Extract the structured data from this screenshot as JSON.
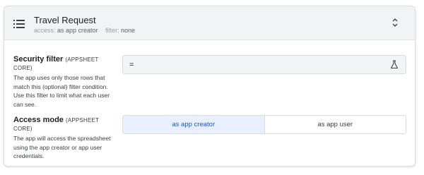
{
  "header": {
    "title": "Travel Request",
    "access_key": "access:",
    "access_value": "as app creator",
    "filter_key": "filter:",
    "filter_value": "none"
  },
  "security_filter": {
    "title": "Security filter",
    "tag": "(APPSHEET CORE)",
    "description": "The app uses only those rows that match this (optional) filter condition. Use this filter to limit what each user can see.",
    "value": "="
  },
  "access_mode": {
    "title": "Access mode",
    "tag": "(APPSHEET CORE)",
    "description": "The app will access the spreadsheet using the app creator or app user credentials.",
    "options": [
      "as app creator",
      "as app user"
    ],
    "selected": "as app creator"
  },
  "colors": {
    "header_bg": "#f1f3f4",
    "active_bg": "#e8f0fe",
    "active_text": "#1a57c5"
  },
  "icons": {
    "header": "list-icon",
    "expand": "unfold-icon",
    "test": "flask-icon"
  }
}
